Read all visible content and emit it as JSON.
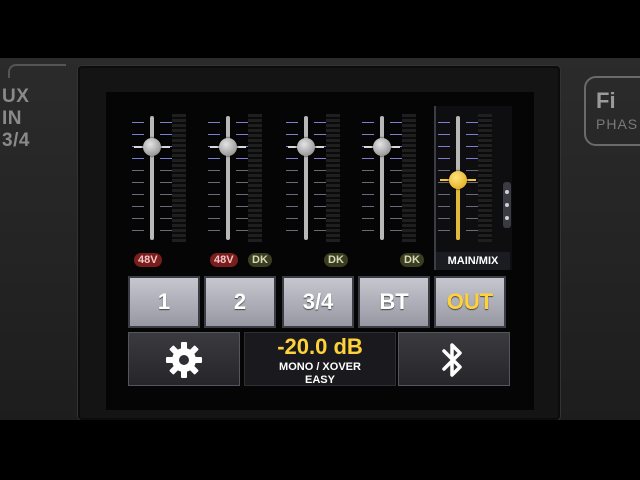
{
  "hardware": {
    "left_label": "UX IN\n3/4",
    "logo_main": "Fi",
    "logo_sub": "PHAS"
  },
  "faders": [
    {
      "id": "1",
      "level": 0.75,
      "active": false,
      "badges": [
        "48V"
      ]
    },
    {
      "id": "2",
      "level": 0.75,
      "active": false,
      "badges": [
        "48V",
        "DK"
      ]
    },
    {
      "id": "3/4",
      "level": 0.75,
      "active": false,
      "badges": [
        "DK"
      ]
    },
    {
      "id": "BT",
      "level": 0.75,
      "active": false,
      "badges": [
        "DK"
      ]
    },
    {
      "id": "OUT",
      "level": 0.48,
      "active": true,
      "badges": []
    }
  ],
  "main_label": "MAIN/MIX",
  "channel_buttons": [
    {
      "label": "1"
    },
    {
      "label": "2"
    },
    {
      "label": "3/4"
    },
    {
      "label": "BT"
    },
    {
      "label": "OUT",
      "selected": true
    }
  ],
  "status": {
    "level": "-20.0 dB",
    "line1": "MONO / XOVER",
    "line2": "EASY"
  },
  "icons": {
    "settings": "gear-icon",
    "bluetooth": "bluetooth-icon"
  },
  "colors": {
    "accent": "#ffd23a",
    "phantom_badge": "#7a1d1d",
    "dk_badge": "#3a3f22",
    "button_face": "#b0b0ba"
  }
}
